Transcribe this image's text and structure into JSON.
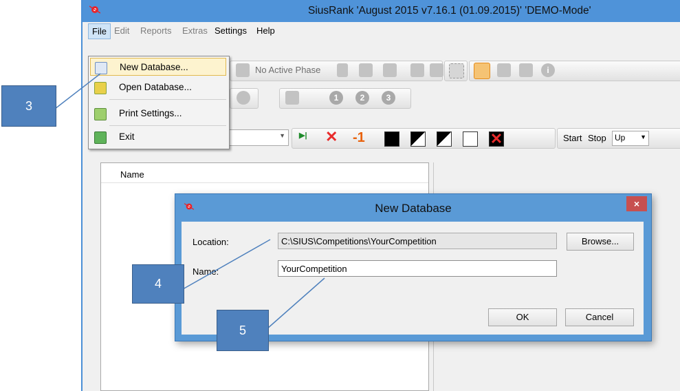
{
  "app": {
    "title": "SiusRank   'August 2015 v7.16.1 (01.09.2015)' 'DEMO-Mode'",
    "menu": [
      "File",
      "Edit",
      "Reports",
      "Extras",
      "Settings",
      "Help"
    ],
    "toolbar": {
      "phase_label": "No Active Phase",
      "minus_one": "-1",
      "start_label": "Start",
      "stop_label": "Stop",
      "direction_value": "Up",
      "round_numbers": [
        "1",
        "2",
        "3"
      ]
    },
    "list_header": "Name"
  },
  "file_menu": {
    "items": [
      "New Database...",
      "Open Database...",
      "Print Settings...",
      "Exit"
    ]
  },
  "dialog": {
    "title": "New Database",
    "close_glyph": "×",
    "location_label": "Location:",
    "location_value": "C:\\SIUS\\Competitions\\YourCompetition",
    "browse_label": "Browse...",
    "name_label": "Name:",
    "name_value": "YourCompetition",
    "ok_label": "OK",
    "cancel_label": "Cancel"
  },
  "callouts": [
    "3",
    "4",
    "5"
  ],
  "colors": {
    "titlebar": "#4f93d9",
    "dialog_frame": "#5a9ad6",
    "close_button": "#c75050",
    "callout": "#4f81bd",
    "menu_highlight": "#fdf3cf"
  },
  "icons": [
    "app-logo-icon",
    "new-database-icon",
    "open-database-icon",
    "print-settings-icon",
    "exit-icon",
    "close-icon",
    "dropdown-arrow-icon"
  ]
}
